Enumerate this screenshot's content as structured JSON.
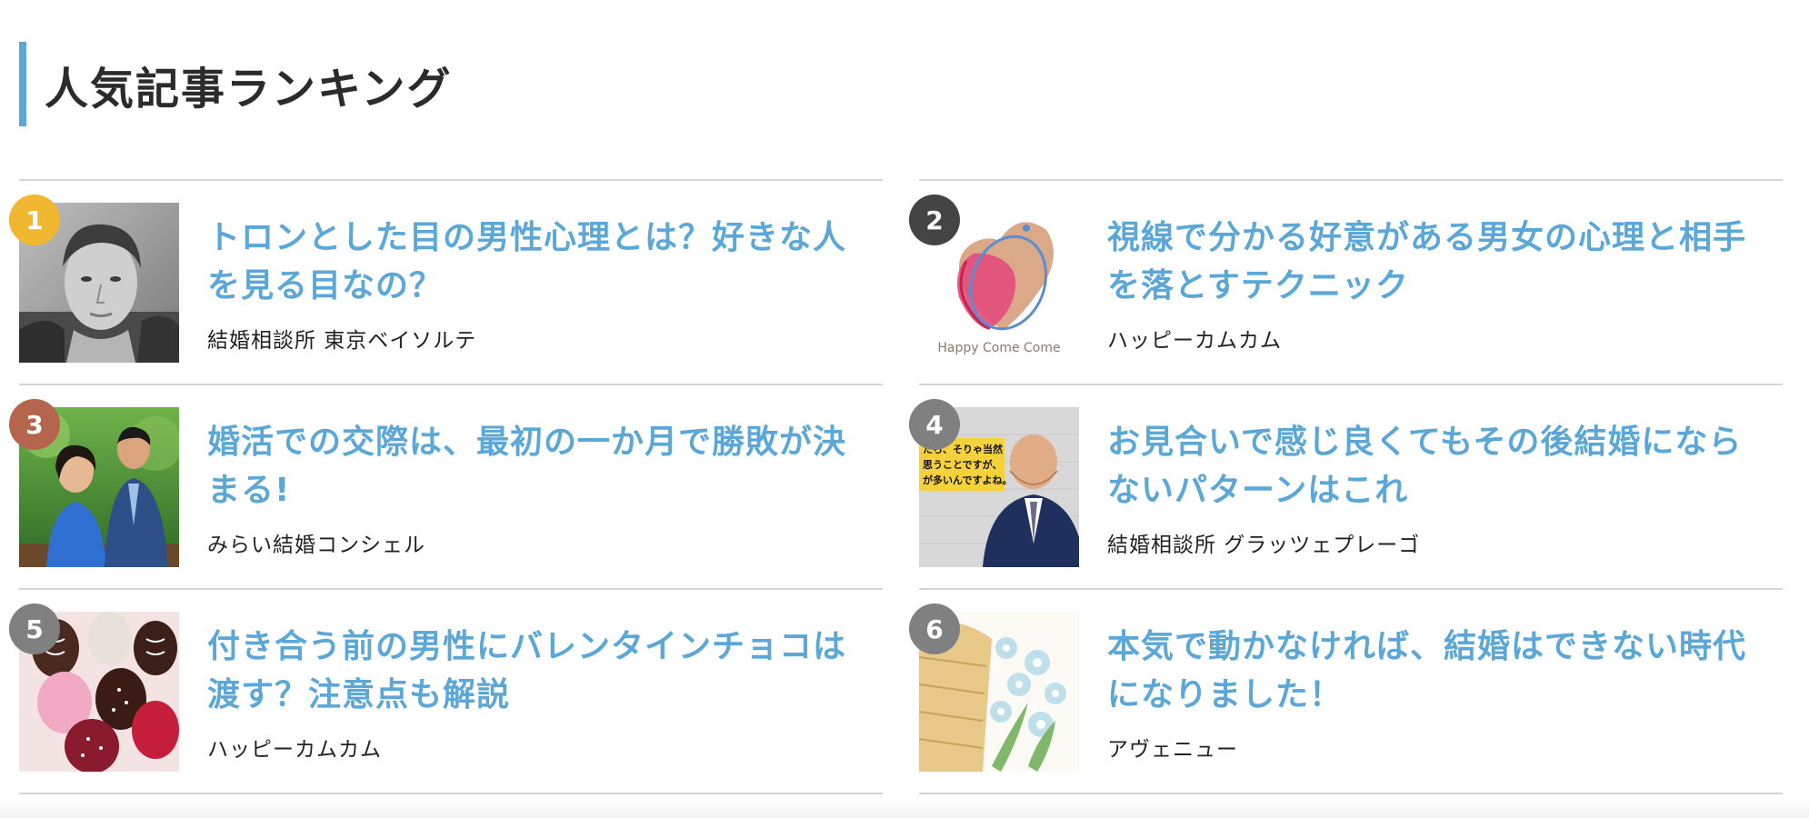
{
  "section": {
    "title": "人気記事ランキング",
    "accent_color": "#5aa7d8"
  },
  "ranking": [
    {
      "rank": "1",
      "badge_color": "#f2b731",
      "title": "トロンとした目の男性心理とは？好きな人を見る目なの？",
      "source": "結婚相談所 東京ベイソルテ",
      "thumbnail": "man-portrait-photo"
    },
    {
      "rank": "2",
      "badge_color": "#444444",
      "title": "視線で分かる好意がある男女の心理と相手を落とすテクニック",
      "source": "ハッピーカムカム",
      "thumbnail": "happy-come-come-logo",
      "logo_text": "Happy Come Come"
    },
    {
      "rank": "3",
      "badge_color": "#b5654e",
      "title": "婚活での交際は、最初の一か月で勝敗が決まる!",
      "source": "みらい結婚コンシェル",
      "thumbnail": "couple-on-bench-photo"
    },
    {
      "rank": "4",
      "badge_color": "#808080",
      "title": "お見合いで感じ良くてもその後結婚にならないパターンはこれ",
      "source": "結婚相談所 グラッツェプレーゴ",
      "thumbnail": "man-in-suit-photo",
      "caption_lines": [
        "たら、そりゃ当然",
        "思うことですが、",
        "が多いんですよね。"
      ]
    },
    {
      "rank": "5",
      "badge_color": "#808080",
      "title": "付き合う前の男性にバレンタインチョコは渡す？注意点も解説",
      "source": "ハッピーカムカム",
      "thumbnail": "chocolate-strawberries-photo"
    },
    {
      "rank": "6",
      "badge_color": "#808080",
      "title": "本気で動かなければ、結婚はできない時代になりました！",
      "source": "アヴェニュー",
      "thumbnail": "flower-basket-photo"
    }
  ]
}
